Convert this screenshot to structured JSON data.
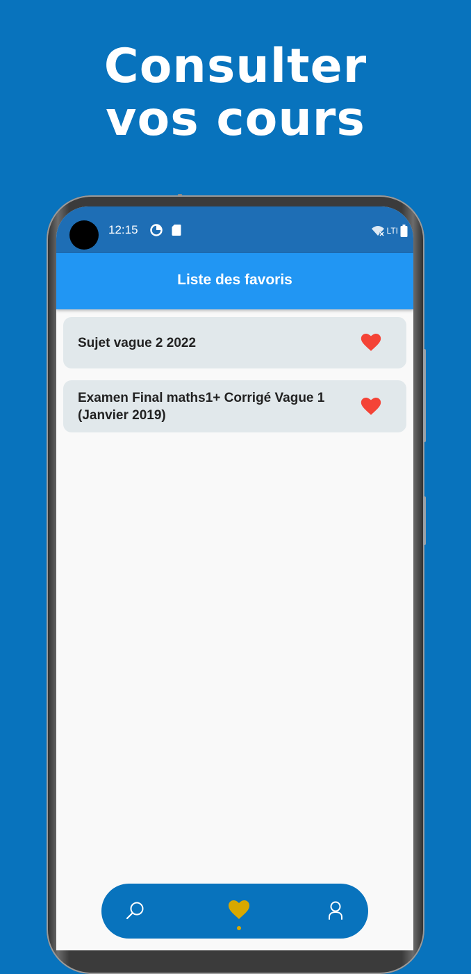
{
  "promo": {
    "line1": "Consulter",
    "line2": "vos cours"
  },
  "statusbar": {
    "time": "12:15",
    "network": "LTI"
  },
  "appbar": {
    "title": "Liste des favoris"
  },
  "favorites": [
    {
      "title": "Sujet vague 2 2022",
      "icon": "heart-icon"
    },
    {
      "title": "Examen Final maths1+ Corrigé Vague 1 (Janvier 2019)",
      "icon": "heart-icon"
    }
  ],
  "bottom_nav": {
    "items": [
      {
        "icon": "search-icon",
        "active": false
      },
      {
        "icon": "heart-icon",
        "active": true
      },
      {
        "icon": "profile-icon",
        "active": false
      }
    ]
  },
  "colors": {
    "background": "#0873bd",
    "appbar": "#2196f3",
    "statusbar": "#1e6eb5",
    "card": "#e1e8eb",
    "heart": "#f44336",
    "active_nav": "#d8a800"
  }
}
